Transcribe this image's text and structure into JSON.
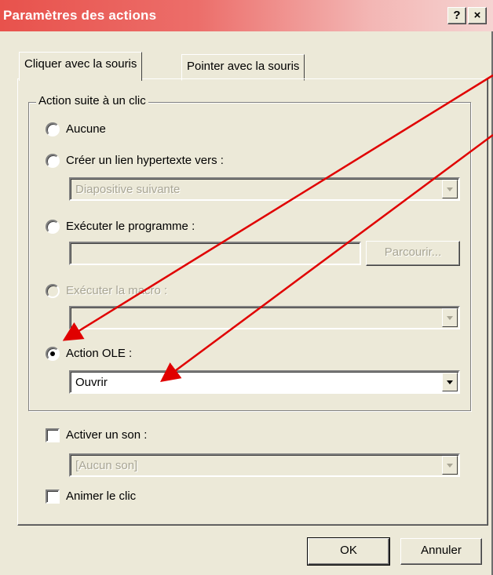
{
  "window": {
    "title": "Paramètres des actions",
    "help_label": "?",
    "close_label": "×"
  },
  "tabs": [
    {
      "label": "Cliquer avec la souris",
      "active": true
    },
    {
      "label": "Pointer avec la souris",
      "active": false
    }
  ],
  "group": {
    "legend": "Action suite à un clic"
  },
  "options": {
    "none_label": "Aucune",
    "hyperlink_label": "Créer un lien hypertexte vers :",
    "hyperlink_value": "Diapositive suivante",
    "program_label": "Exécuter le programme :",
    "program_value": "",
    "browse_label": "Parcourir...",
    "macro_label": "Exécuter la macro :",
    "macro_value": "",
    "ole_label": "Action OLE :",
    "ole_value": "Ouvrir",
    "selected": "ole"
  },
  "sound": {
    "label": "Activer un son :",
    "value": "[Aucun son]",
    "checked": false
  },
  "animate": {
    "label": "Animer le clic",
    "checked": false
  },
  "buttons": {
    "ok": "OK",
    "cancel": "Annuler"
  },
  "colors": {
    "title_gradient_start": "#e8524c",
    "dialog_bg": "#ece9d8",
    "annotation_arrow": "#e00000"
  }
}
